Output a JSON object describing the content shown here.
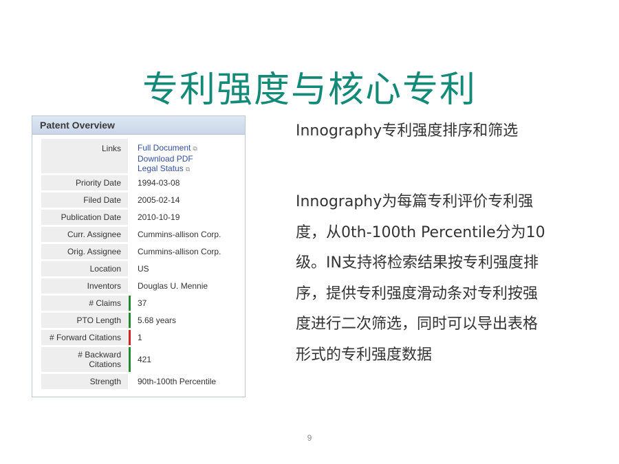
{
  "slide": {
    "title": "专利强度与核心专利",
    "subtitle": "Innography专利强度排序和筛选",
    "paragraph_lines": [
      "Innography为每篇专利评价专利强",
      "度，从0th-100th Percentile分为10",
      "级。IN支持将检索结果按专利强度排",
      "序，提供专利强度滑动条对专利按强",
      "度进行二次筛选，同时可以导出表格",
      "形式的专利强度数据"
    ],
    "page_number": "9"
  },
  "panel": {
    "header": "Patent Overview",
    "links_label": "Links",
    "links": [
      "Full Document",
      "Download PDF",
      "Legal Status"
    ],
    "rows": [
      {
        "label": "Priority Date",
        "value": "1994-03-08"
      },
      {
        "label": "Filed Date",
        "value": "2005-02-14"
      },
      {
        "label": "Publication Date",
        "value": "2010-10-19"
      },
      {
        "label": "Curr. Assignee",
        "value": "Cummins-allison Corp."
      },
      {
        "label": "Orig. Assignee",
        "value": "Cummins-allison Corp."
      },
      {
        "label": "Location",
        "value": "US"
      },
      {
        "label": "Inventors",
        "value": "Douglas U. Mennie"
      },
      {
        "label": "# Claims",
        "value": "37"
      },
      {
        "label": "PTO Length",
        "value": "5.68 years"
      },
      {
        "label": "# Forward Citations",
        "value": "1"
      },
      {
        "label": "# Backward Citations",
        "value": "421"
      },
      {
        "label": "Strength",
        "value": "90th-100th Percentile"
      }
    ],
    "colors": {
      "bar_green": "#1f8a2e",
      "bar_red": "#d42020",
      "link_blue": "#2f4fa3",
      "link_purple": "#5b2b93",
      "title_teal": "#138a78"
    }
  }
}
